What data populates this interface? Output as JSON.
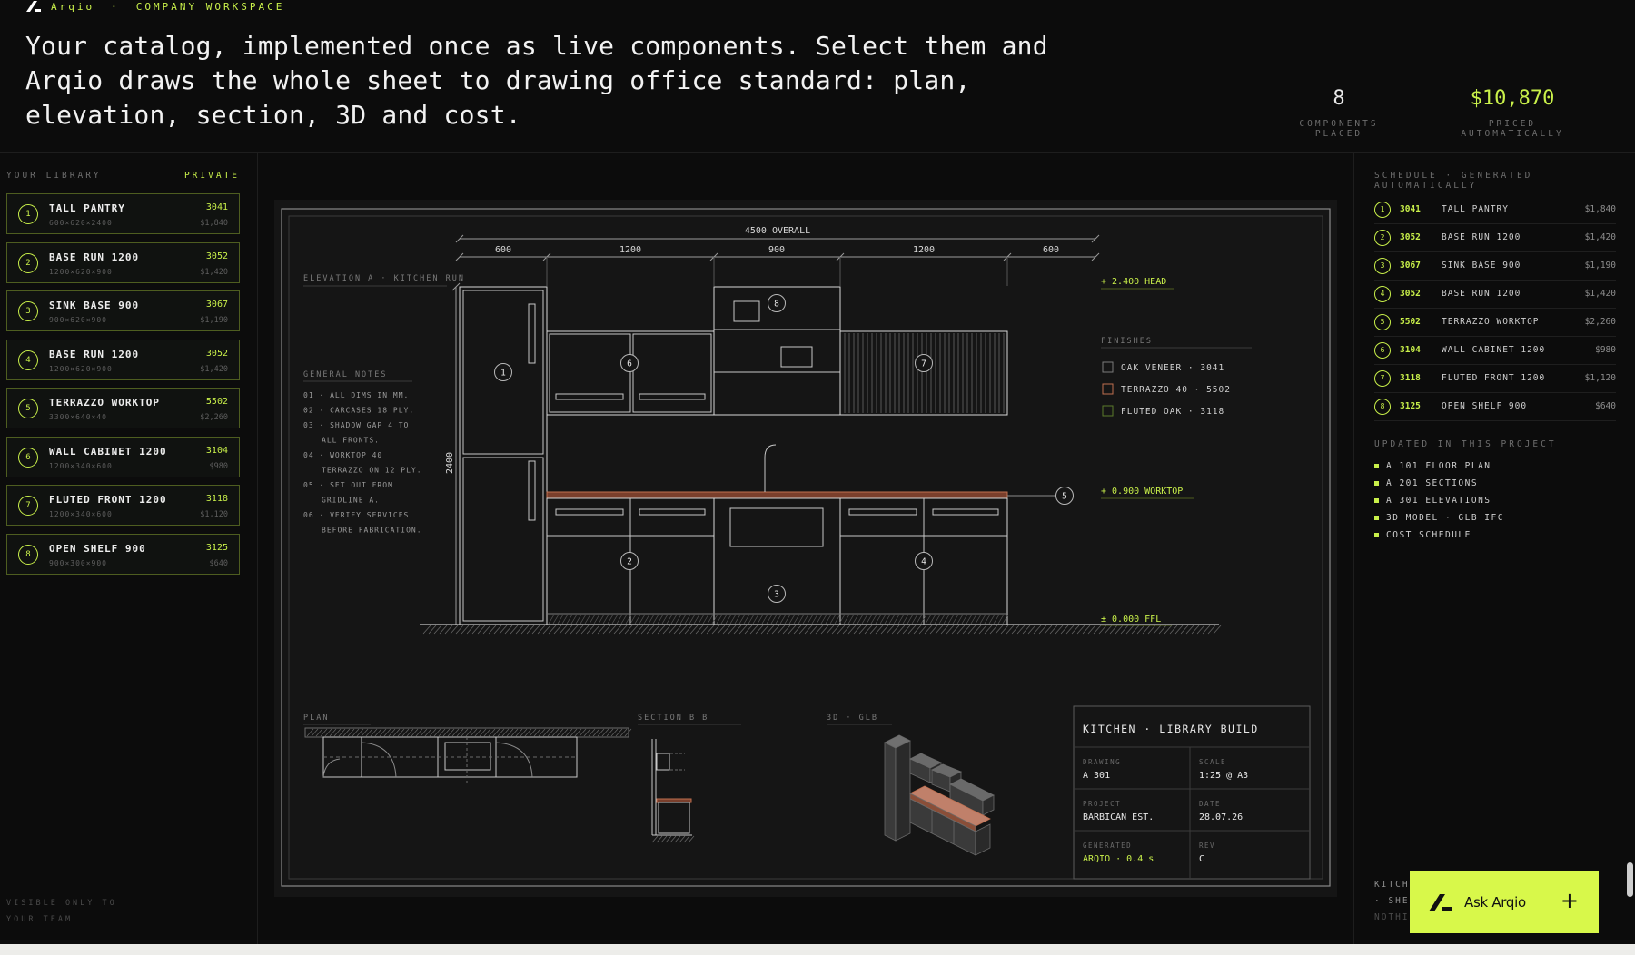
{
  "brand": {
    "name": "Arqio",
    "separator": "·",
    "workspace": "COMPANY WORKSPACE"
  },
  "headline": "Your catalog, implemented once as live components. Select them and Arqio draws the whole sheet to drawing office standard: plan, elevation, section, 3D and cost.",
  "stats": {
    "placed": {
      "value": "8",
      "label": "COMPONENTS PLACED"
    },
    "priced": {
      "value": "$10,870",
      "label": "PRICED AUTOMATICALLY"
    }
  },
  "library": {
    "title": "YOUR LIBRARY",
    "badge": "PRIVATE",
    "items": [
      {
        "num": "1",
        "name": "TALL PANTRY",
        "dims": "600×620×2400",
        "code": "3041",
        "price": "$1,840"
      },
      {
        "num": "2",
        "name": "BASE RUN 1200",
        "dims": "1200×620×900",
        "code": "3052",
        "price": "$1,420"
      },
      {
        "num": "3",
        "name": "SINK BASE 900",
        "dims": "900×620×900",
        "code": "3067",
        "price": "$1,190"
      },
      {
        "num": "4",
        "name": "BASE RUN 1200",
        "dims": "1200×620×900",
        "code": "3052",
        "price": "$1,420"
      },
      {
        "num": "5",
        "name": "TERRAZZO WORKTOP",
        "dims": "3300×640×40",
        "code": "5502",
        "price": "$2,260"
      },
      {
        "num": "6",
        "name": "WALL CABINET 1200",
        "dims": "1200×340×600",
        "code": "3104",
        "price": "$980"
      },
      {
        "num": "7",
        "name": "FLUTED FRONT 1200",
        "dims": "1200×340×600",
        "code": "3118",
        "price": "$1,120"
      },
      {
        "num": "8",
        "name": "OPEN SHELF 900",
        "dims": "900×300×900",
        "code": "3125",
        "price": "$640"
      }
    ],
    "footer_line1": "VISIBLE ONLY TO",
    "footer_line2": "YOUR TEAM"
  },
  "sheet": {
    "overall": "4500 OVERALL",
    "dims": [
      "600",
      "1200",
      "900",
      "1200",
      "600"
    ],
    "elevation_label": "ELEVATION A · KITCHEN RUN",
    "height_dim": "2400",
    "levels": {
      "head": "+ 2.400 HEAD",
      "worktop": "+ 0.900 WORKTOP",
      "ffl": "± 0.000 FFL"
    },
    "notes_title": "GENERAL NOTES",
    "notes": [
      "01 · ALL DIMS IN MM.",
      "02 · CARCASES 18 PLY.",
      "03 · SHADOW GAP 4 TO",
      "ALL FRONTS.",
      "04 · WORKTOP 40",
      "TERRAZZO ON 12 PLY.",
      "05 · SET OUT FROM",
      "GRIDLINE A.",
      "06 · VERIFY SERVICES",
      "BEFORE FABRICATION."
    ],
    "finishes_title": "FINISHES",
    "finishes": [
      {
        "label": "OAK VENEER · 3041",
        "color": "#7a7a7a"
      },
      {
        "label": "TERRAZZO 40 · 5502",
        "color": "#c07050"
      },
      {
        "label": "FLUTED OAK · 3118",
        "color": "#5a7a2a"
      }
    ],
    "tags": [
      "1",
      "2",
      "3",
      "4",
      "5",
      "6",
      "7",
      "8"
    ],
    "plan_label": "PLAN",
    "section_label": "SECTION B B",
    "iso_label": "3D · GLB",
    "title_block": {
      "title": "KITCHEN · LIBRARY BUILD",
      "drawing_label": "DRAWING",
      "drawing": "A 301",
      "scale_label": "SCALE",
      "scale": "1:25 @ A3",
      "project_label": "PROJECT",
      "project": "BARBICAN EST.",
      "date_label": "DATE",
      "date": "28.07.26",
      "generated_label": "GENERATED",
      "generated": "ARQIO · 0.4 s",
      "rev_label": "REV",
      "rev": "C"
    }
  },
  "schedule": {
    "title": "SCHEDULE · GENERATED AUTOMATICALLY",
    "rows": [
      {
        "num": "1",
        "code": "3041",
        "name": "TALL PANTRY",
        "price": "$1,840"
      },
      {
        "num": "2",
        "code": "3052",
        "name": "BASE RUN 1200",
        "price": "$1,420"
      },
      {
        "num": "3",
        "code": "3067",
        "name": "SINK BASE 900",
        "price": "$1,190"
      },
      {
        "num": "4",
        "code": "3052",
        "name": "BASE RUN 1200",
        "price": "$1,420"
      },
      {
        "num": "5",
        "code": "5502",
        "name": "TERRAZZO WORKTOP",
        "price": "$2,260"
      },
      {
        "num": "6",
        "code": "3104",
        "name": "WALL CABINET 1200",
        "price": "$980"
      },
      {
        "num": "7",
        "code": "3118",
        "name": "FLUTED FRONT 1200",
        "price": "$1,120"
      },
      {
        "num": "8",
        "code": "3125",
        "name": "OPEN SHELF 900",
        "price": "$640"
      }
    ],
    "updated_title": "UPDATED IN THIS PROJECT",
    "updated": [
      "A 101 FLOOR PLAN",
      "A 201 SECTIONS",
      "A 301 ELEVATIONS",
      "3D MODEL · GLB IFC",
      "COST SCHEDULE"
    ],
    "footer_line1": "KITCH",
    "footer_line2": "· SHE",
    "footer_line3": "NOTHI"
  },
  "ask": {
    "label": "Ask Arqio",
    "plus": "+"
  },
  "colors": {
    "accent": "#c9f04a",
    "worktop": "#c07050",
    "line": "#9a9a9a"
  }
}
